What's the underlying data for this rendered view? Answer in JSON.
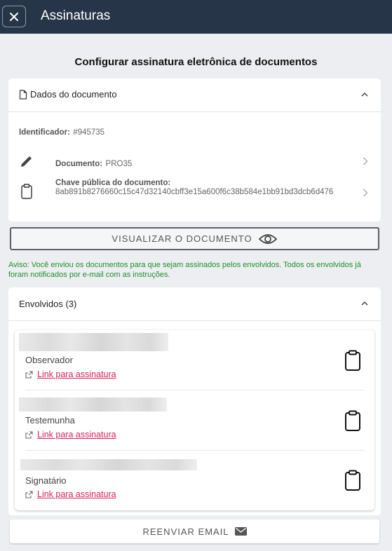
{
  "header": {
    "title": "Assinaturas",
    "close_icon": "close-icon"
  },
  "page": {
    "heading": "Configurar assinatura eletrônica de documentos"
  },
  "document_card": {
    "title": "Dados do documento",
    "identifier_label": "Identificador:",
    "identifier_value": "#945735",
    "document_label": "Documento:",
    "document_value": "PRO35",
    "public_key_label": "Chave pública do documento:",
    "public_key_value": "8ab891b8276660c15c47d32140cbff3e15a600f6c38b584e1bb91bd3dcb6d476"
  },
  "view_button": {
    "label": "VISUALIZAR O DOCUMENTO"
  },
  "notice": "Aviso: Você enviou os documentos para que sejam assinados pelos envolvidos. Todos os envolvidos já foram notificados por e-mail com as instruções.",
  "involved_card": {
    "title": "Envolvidos (3)",
    "people": [
      {
        "role": "Observador",
        "link": "Link para assinatura"
      },
      {
        "role": "Testemunha",
        "link": "Link para assinatura"
      },
      {
        "role": "Signatário",
        "link": "Link para assinatura"
      }
    ]
  },
  "resend_button": {
    "label": "REENVIAR EMAIL"
  },
  "colors": {
    "header_bg": "#263548",
    "link": "#d8225a",
    "notice": "#1f8f2a",
    "page_bg": "#eceef1"
  }
}
